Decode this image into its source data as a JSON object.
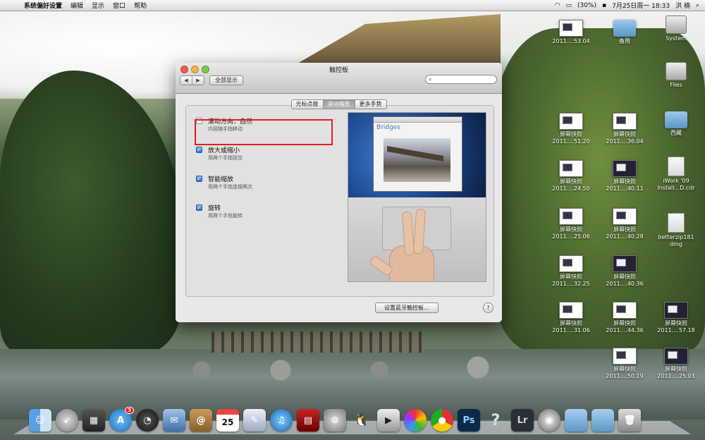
{
  "menubar": {
    "app_name": "系统偏好设置",
    "menus": [
      "编辑",
      "显示",
      "窗口",
      "帮助"
    ],
    "battery": "(30%)",
    "datetime": "7月25日周一  18:33",
    "user": "洪 楠"
  },
  "window": {
    "title": "触控板",
    "show_all": "全部显示",
    "search_placeholder": "",
    "tabs": [
      "光标点按",
      "滚动缩放",
      "更多手势"
    ],
    "options": [
      {
        "label": "滚动方向：自然",
        "desc": "内容随手指移动",
        "checked": false
      },
      {
        "label": "放大或缩小",
        "desc": "用两个手指捏合",
        "checked": true
      },
      {
        "label": "智能缩放",
        "desc": "用两个手指连按两次",
        "checked": true
      },
      {
        "label": "旋转",
        "desc": "用两个手指旋转",
        "checked": true
      }
    ],
    "preview_heading": "Bridges",
    "bluetooth_button": "设置蓝牙触控板...",
    "help": "?"
  },
  "desktop_icons": [
    {
      "label1": "2011....53.04",
      "label2": ""
    },
    {
      "label1": "备用",
      "label2": ""
    },
    {
      "label1": "System",
      "label2": ""
    },
    {
      "label1": "Files",
      "label2": ""
    },
    {
      "label1": "屏幕快照",
      "label2": "2011....51.20"
    },
    {
      "label1": "屏幕快照",
      "label2": "2011....36.04"
    },
    {
      "label1": "西藏",
      "label2": ""
    },
    {
      "label1": "屏幕快照",
      "label2": "2011....24.50"
    },
    {
      "label1": "屏幕快照",
      "label2": "2011....40.11"
    },
    {
      "label1": "iWork '09",
      "label2": "Install...D.cdr"
    },
    {
      "label1": "屏幕快照",
      "label2": "2011....25.06"
    },
    {
      "label1": "屏幕快照",
      "label2": "2011....40.28"
    },
    {
      "label1": "betterzip181",
      "label2": "dmg"
    },
    {
      "label1": "屏幕快照",
      "label2": "2011....32.25"
    },
    {
      "label1": "屏幕快照",
      "label2": "2011....40.36"
    },
    {
      "label1": "屏幕快照",
      "label2": "2011....31.06"
    },
    {
      "label1": "屏幕快照",
      "label2": "2011....44.36"
    },
    {
      "label1": "屏幕快照",
      "label2": "2011....57.18"
    },
    {
      "label1": "屏幕快照",
      "label2": "2011....50.19"
    },
    {
      "label1": "屏幕快照",
      "label2": "2011....25.03"
    }
  ],
  "dock": {
    "calendar_day": "25",
    "appstore_badge": "3",
    "ps_label": "Ps",
    "lr_label": "Lr",
    "help_glyph": "?"
  },
  "colors": {
    "highlight": "#e0201b",
    "checkbox": "#2f6fc7"
  }
}
